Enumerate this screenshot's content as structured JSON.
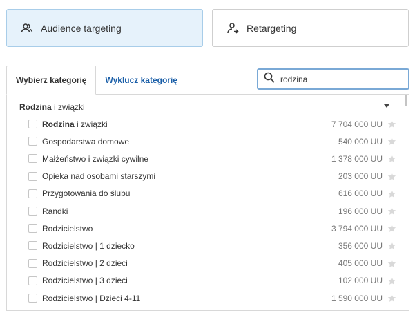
{
  "modes": {
    "audience": {
      "label": "Audience targeting",
      "icon": "audience-icon"
    },
    "retargeting": {
      "label": "Retargeting",
      "icon": "retargeting-icon"
    }
  },
  "tabs": [
    {
      "label": "Wybierz kategorię"
    },
    {
      "label": "Wyklucz kategorię"
    }
  ],
  "search": {
    "value": "rodzina",
    "icon": "search-icon"
  },
  "group": {
    "bold": "Rodzina",
    "rest": " i związki"
  },
  "items": [
    {
      "bold": "Rodzina",
      "rest": " i związki",
      "count": "7 704 000 UU"
    },
    {
      "bold": "",
      "rest": "Gospodarstwa domowe",
      "count": "540 000 UU"
    },
    {
      "bold": "",
      "rest": "Małżeństwo i związki cywilne",
      "count": "1 378 000 UU"
    },
    {
      "bold": "",
      "rest": "Opieka nad osobami starszymi",
      "count": "203 000 UU"
    },
    {
      "bold": "",
      "rest": "Przygotowania do ślubu",
      "count": "616 000 UU"
    },
    {
      "bold": "",
      "rest": "Randki",
      "count": "196 000 UU"
    },
    {
      "bold": "",
      "rest": "Rodzicielstwo",
      "count": "3 794 000 UU"
    },
    {
      "bold": "",
      "rest": "Rodzicielstwo | 1 dziecko",
      "count": "356 000 UU"
    },
    {
      "bold": "",
      "rest": "Rodzicielstwo | 2 dzieci",
      "count": "405 000 UU"
    },
    {
      "bold": "",
      "rest": "Rodzicielstwo | 3 dzieci",
      "count": "102 000 UU"
    },
    {
      "bold": "",
      "rest": "Rodzicielstwo | Dzieci 4-11",
      "count": "1 590 000 UU"
    }
  ],
  "colors": {
    "active_card": "#e6f2fb",
    "link": "#1b5fa8",
    "search_border": "#7aa9d6"
  }
}
